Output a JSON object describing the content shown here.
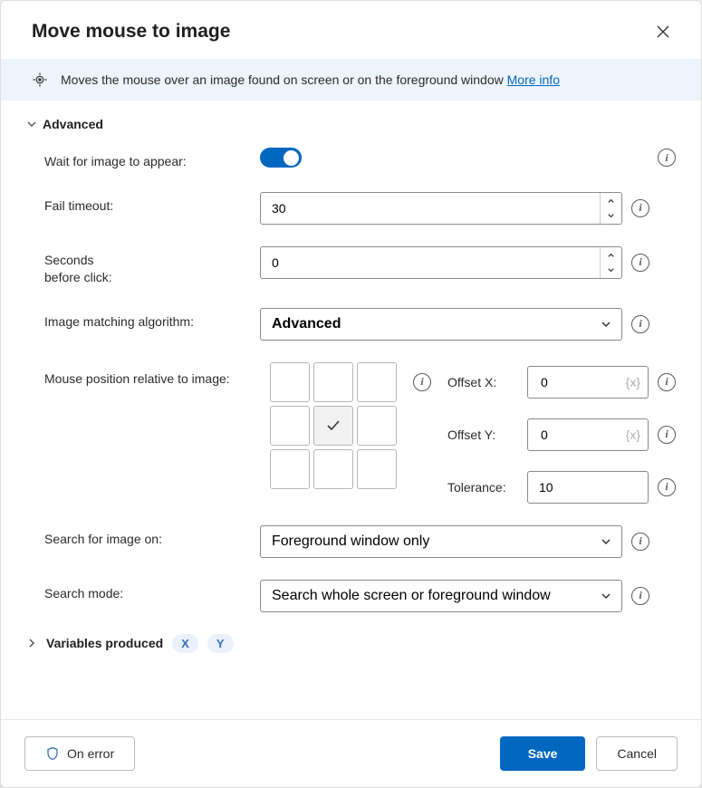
{
  "title": "Move mouse to image",
  "banner": {
    "text": "Moves the mouse over an image found on screen or on the foreground window ",
    "more_info": "More info"
  },
  "sections": {
    "advanced": "Advanced",
    "variables_produced": "Variables produced"
  },
  "fields": {
    "wait_for_image": {
      "label": "Wait for image to appear:",
      "value": true
    },
    "fail_timeout": {
      "label": "Fail timeout:",
      "value": "30"
    },
    "seconds_before_click": {
      "label": "Seconds\nbefore click:",
      "value": "0"
    },
    "algorithm": {
      "label": "Image matching algorithm:",
      "value": "Advanced"
    },
    "mouse_position": {
      "label": "Mouse position relative to image:",
      "selected_index": 4
    },
    "offset_x": {
      "label": "Offset X:",
      "value": "0",
      "hint": "{x}"
    },
    "offset_y": {
      "label": "Offset Y:",
      "value": "0",
      "hint": "{x}"
    },
    "tolerance": {
      "label": "Tolerance:",
      "value": "10"
    },
    "search_on": {
      "label": "Search for image on:",
      "value": "Foreground window only"
    },
    "search_mode": {
      "label": "Search mode:",
      "value": "Search whole screen or foreground window"
    }
  },
  "variables": [
    "X",
    "Y"
  ],
  "footer": {
    "on_error": "On error",
    "save": "Save",
    "cancel": "Cancel"
  }
}
